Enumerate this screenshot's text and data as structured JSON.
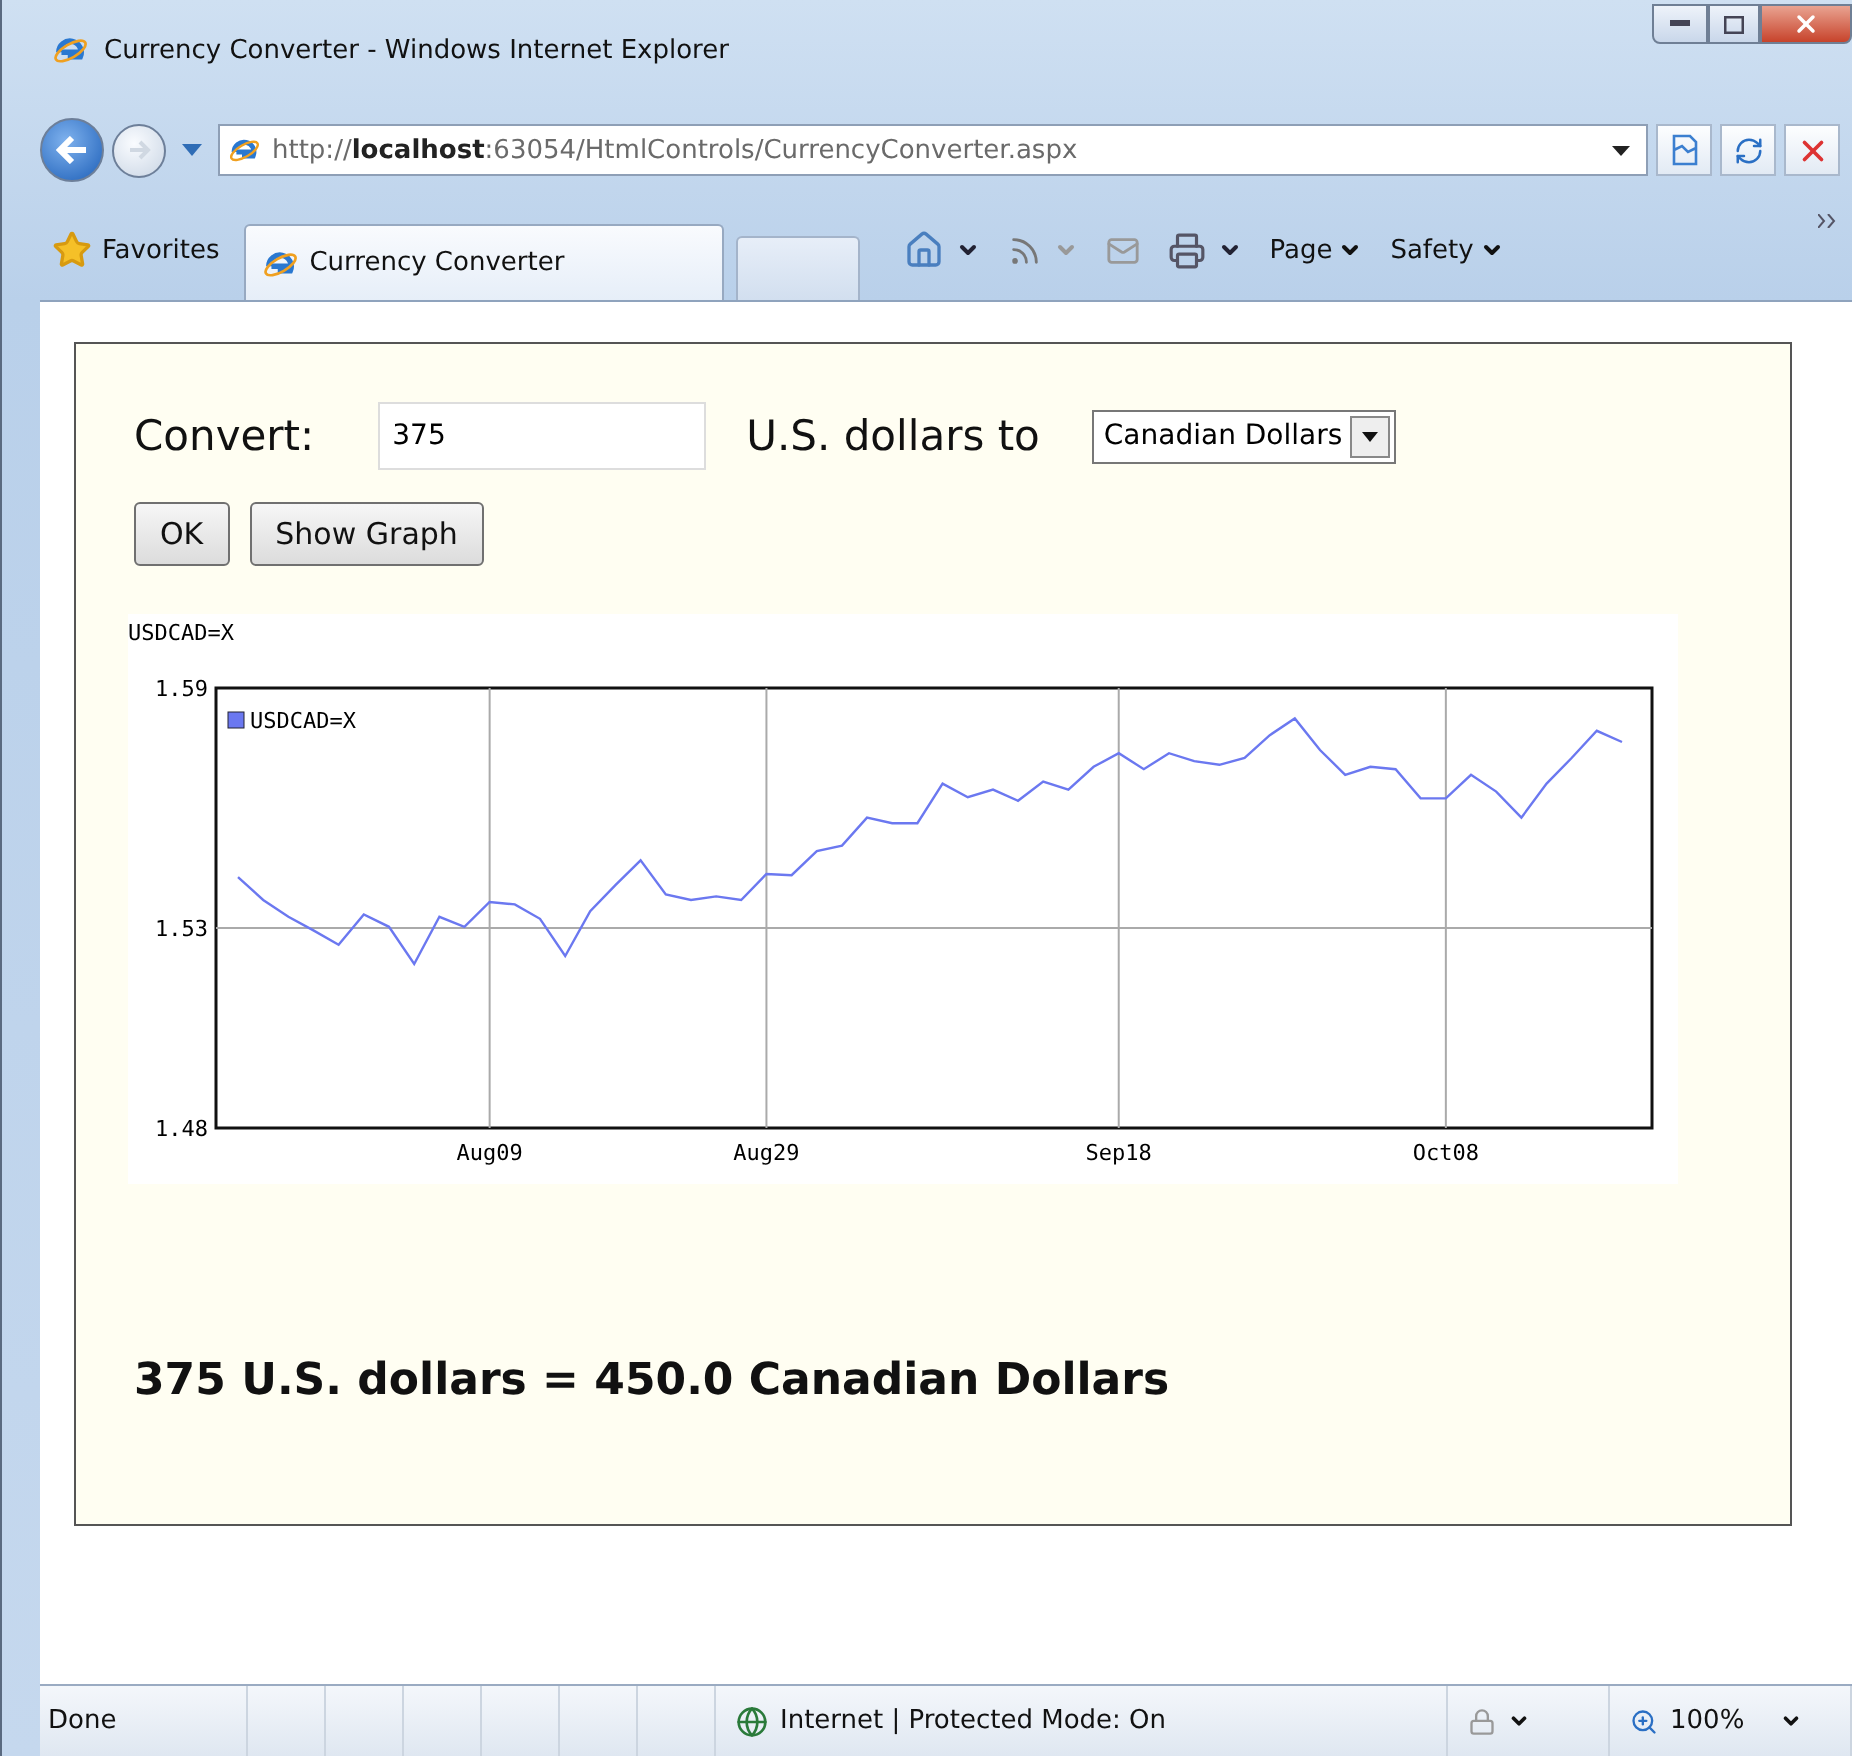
{
  "window": {
    "title": "Currency Converter - Windows Internet Explorer"
  },
  "address_bar": {
    "url": "http://**localhost**:63054/HtmlControls/CurrencyConverter.aspx"
  },
  "favorites": {
    "label": "Favorites"
  },
  "tabs": [
    {
      "label": "Currency Converter",
      "selected": true
    }
  ],
  "command_bar": {
    "menus": [
      "Page",
      "Safety"
    ]
  },
  "page": {
    "convert_label": "Convert:",
    "amount": {
      "value": "375"
    },
    "unit_label": "U.S. dollars to",
    "currency": {
      "value": "Canadian Dollars"
    },
    "buttons": [
      "OK",
      "Show Graph"
    ],
    "chart": {
      "chart_data": {
        "type": "line",
        "title": "USDCAD=X",
        "ylim": [
          1.48,
          1.59
        ],
        "categories": [
          null,
          null,
          null,
          null,
          null,
          null,
          null,
          null,
          null,
          null,
          "Aug09",
          null,
          null,
          null,
          null,
          null,
          null,
          null,
          null,
          null,
          null,
          "Aug29",
          null,
          null,
          null,
          null,
          null,
          null,
          null,
          null,
          null,
          null,
          null,
          null,
          null,
          "Sep18",
          null,
          null,
          null,
          null,
          null,
          null,
          null,
          null,
          null,
          null,
          null,
          null,
          "Oct08",
          null,
          null,
          null,
          null,
          null,
          null,
          null
        ],
        "series": [
          {
            "name": "USDCAD=X",
            "color": "#6b78f0",
            "values": [
              1.5427,
              1.537,
              1.5328,
              1.5294,
              1.5258,
              1.5334,
              1.5303,
              1.521,
              1.5328,
              1.5303,
              1.5365,
              1.5359,
              1.5323,
              1.523,
              1.5342,
              1.5407,
              1.5469,
              1.5384,
              1.537,
              1.5379,
              1.537,
              1.5435,
              1.5432,
              1.5492,
              1.5506,
              1.5576,
              1.5562,
              1.5562,
              1.5661,
              1.5627,
              1.5646,
              1.5618,
              1.5666,
              1.5646,
              1.5703,
              1.5737,
              1.5697,
              1.5737,
              1.5717,
              1.5708,
              1.5725,
              1.5782,
              1.5824,
              1.5745,
              1.5683,
              1.5703,
              1.5697,
              1.5624,
              1.5624,
              1.5683,
              1.5641,
              1.5576,
              1.5661,
              1.5725,
              1.5793,
              1.5765
            ]
          }
        ],
        "grid": true,
        "yticks": [
          1.48,
          1.53,
          1.59
        ]
      }
    },
    "result": "375 U.S. dollars = 450.0 Canadian Dollars"
  },
  "status_bar": {
    "status": "Done",
    "zone": "Internet | Protected Mode: On",
    "zoom": "100%"
  }
}
